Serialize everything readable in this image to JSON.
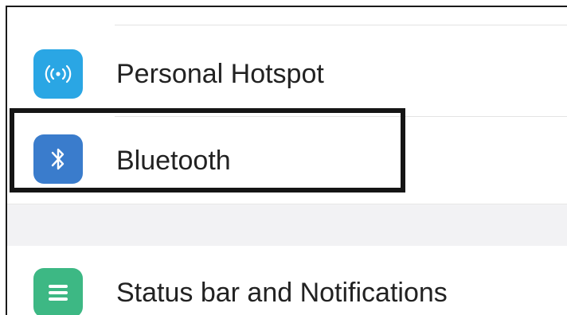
{
  "settings": {
    "items": [
      {
        "label": "Personal Hotspot",
        "icon": "hotspot-icon",
        "icon_color": "#2aa6e4"
      },
      {
        "label": "Bluetooth",
        "icon": "bluetooth-icon",
        "icon_color": "#3a7ccc"
      },
      {
        "label": "Status bar and Notifications",
        "icon": "notifications-list-icon",
        "icon_color": "#3db884"
      }
    ],
    "highlighted_item": "Bluetooth",
    "highlight_color": "#151515"
  }
}
